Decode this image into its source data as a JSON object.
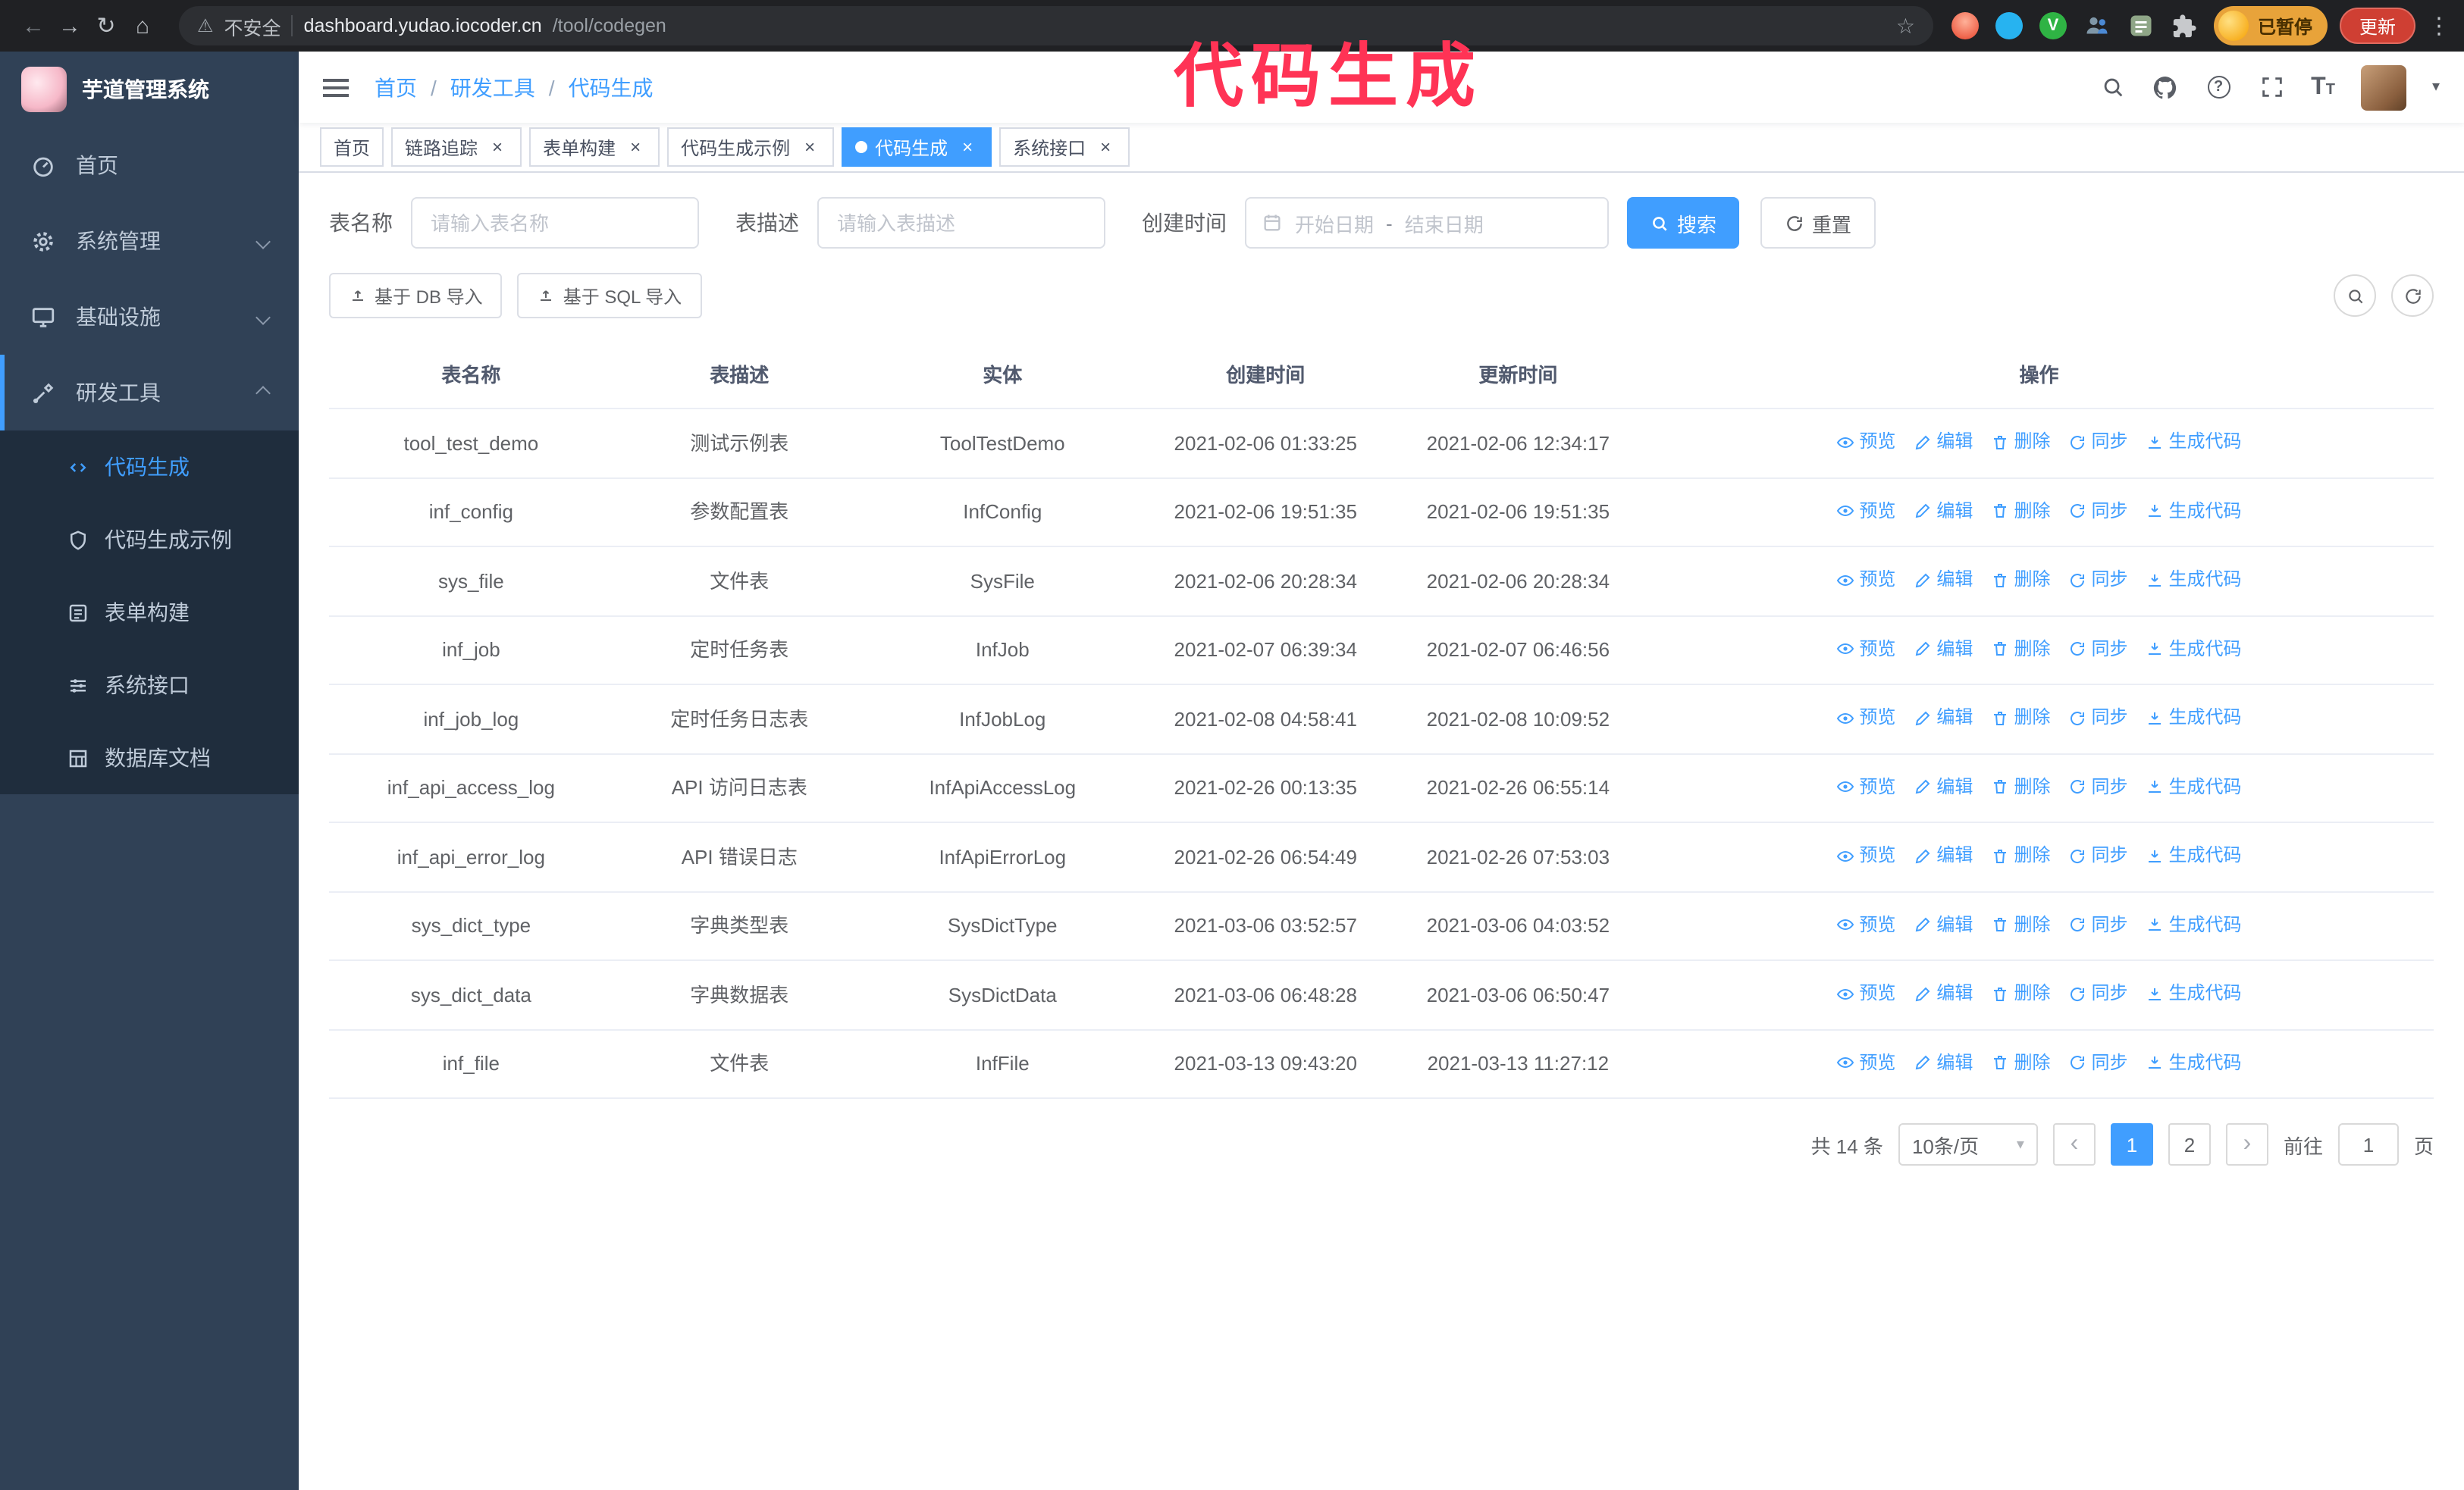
{
  "theme": {
    "primary": "#409eff",
    "sidebar_bg": "#304156",
    "submenu_bg": "#1f2d3d",
    "annotation_color": "#ff3355"
  },
  "glyphs": {
    "back": "←",
    "forward": "→",
    "reload": "↻",
    "home": "⌂",
    "warning": "⚠",
    "star": "☆",
    "dots": "⋮",
    "caret_down": "▾",
    "question": "?",
    "font_size": "T",
    "prev": "‹",
    "next": "›",
    "close": "×"
  },
  "annotation": {
    "text": "代码生成"
  },
  "browser": {
    "insecure": "不安全",
    "host": "dashboard.yudao.iocoder.cn",
    "path": "/tool/codegen",
    "profile_badge": "已暂停",
    "update_button": "更新"
  },
  "sidebar": {
    "title": "芋道管理系统",
    "items": [
      {
        "label": "首页"
      },
      {
        "label": "系统管理"
      },
      {
        "label": "基础设施"
      },
      {
        "label": "研发工具"
      }
    ],
    "subitems": [
      {
        "label": "代码生成",
        "active": true
      },
      {
        "label": "代码生成示例"
      },
      {
        "label": "表单构建"
      },
      {
        "label": "系统接口"
      },
      {
        "label": "数据库文档"
      }
    ]
  },
  "breadcrumb": {
    "separator": "/",
    "items": [
      "首页",
      "研发工具",
      "代码生成"
    ]
  },
  "tabs": [
    {
      "label": "首页",
      "closable": false,
      "active": false
    },
    {
      "label": "链路追踪",
      "closable": true,
      "active": false
    },
    {
      "label": "表单构建",
      "closable": true,
      "active": false
    },
    {
      "label": "代码生成示例",
      "closable": true,
      "active": false
    },
    {
      "label": "代码生成",
      "closable": true,
      "active": true
    },
    {
      "label": "系统接口",
      "closable": true,
      "active": false
    }
  ],
  "filters": {
    "table_name_label": "表名称",
    "table_name_placeholder": "请输入表名称",
    "table_desc_label": "表描述",
    "table_desc_placeholder": "请输入表描述",
    "create_time_label": "创建时间",
    "date_start": "开始日期",
    "date_separator": "-",
    "date_end": "结束日期",
    "search": "搜索",
    "reset": "重置"
  },
  "toolbar": {
    "import_db": "基于 DB 导入",
    "import_sql": "基于 SQL 导入"
  },
  "table": {
    "columns": [
      "表名称",
      "表描述",
      "实体",
      "创建时间",
      "更新时间",
      "操作"
    ],
    "actions": [
      "预览",
      "编辑",
      "删除",
      "同步",
      "生成代码"
    ],
    "rows": [
      {
        "name": "tool_test_demo",
        "desc": "测试示例表",
        "entity": "ToolTestDemo",
        "created": "2021-02-06 01:33:25",
        "updated": "2021-02-06 12:34:17"
      },
      {
        "name": "inf_config",
        "desc": "参数配置表",
        "entity": "InfConfig",
        "created": "2021-02-06 19:51:35",
        "updated": "2021-02-06 19:51:35"
      },
      {
        "name": "sys_file",
        "desc": "文件表",
        "entity": "SysFile",
        "created": "2021-02-06 20:28:34",
        "updated": "2021-02-06 20:28:34"
      },
      {
        "name": "inf_job",
        "desc": "定时任务表",
        "entity": "InfJob",
        "created": "2021-02-07 06:39:34",
        "updated": "2021-02-07 06:46:56"
      },
      {
        "name": "inf_job_log",
        "desc": "定时任务日志表",
        "entity": "InfJobLog",
        "created": "2021-02-08 04:58:41",
        "updated": "2021-02-08 10:09:52"
      },
      {
        "name": "inf_api_access_log",
        "desc": "API 访问日志表",
        "entity": "InfApiAccessLog",
        "created": "2021-02-26 00:13:35",
        "updated": "2021-02-26 06:55:14"
      },
      {
        "name": "inf_api_error_log",
        "desc": "API 错误日志",
        "entity": "InfApiErrorLog",
        "created": "2021-02-26 06:54:49",
        "updated": "2021-02-26 07:53:03"
      },
      {
        "name": "sys_dict_type",
        "desc": "字典类型表",
        "entity": "SysDictType",
        "created": "2021-03-06 03:52:57",
        "updated": "2021-03-06 04:03:52"
      },
      {
        "name": "sys_dict_data",
        "desc": "字典数据表",
        "entity": "SysDictData",
        "created": "2021-03-06 06:48:28",
        "updated": "2021-03-06 06:50:47"
      },
      {
        "name": "inf_file",
        "desc": "文件表",
        "entity": "InfFile",
        "created": "2021-03-13 09:43:20",
        "updated": "2021-03-13 11:27:12"
      }
    ]
  },
  "pagination": {
    "total": "共 14 条",
    "page_size": "10条/页",
    "pages": [
      "1",
      "2"
    ],
    "active_page": "1",
    "goto_label": "前往",
    "goto_value": "1",
    "goto_unit": "页"
  }
}
